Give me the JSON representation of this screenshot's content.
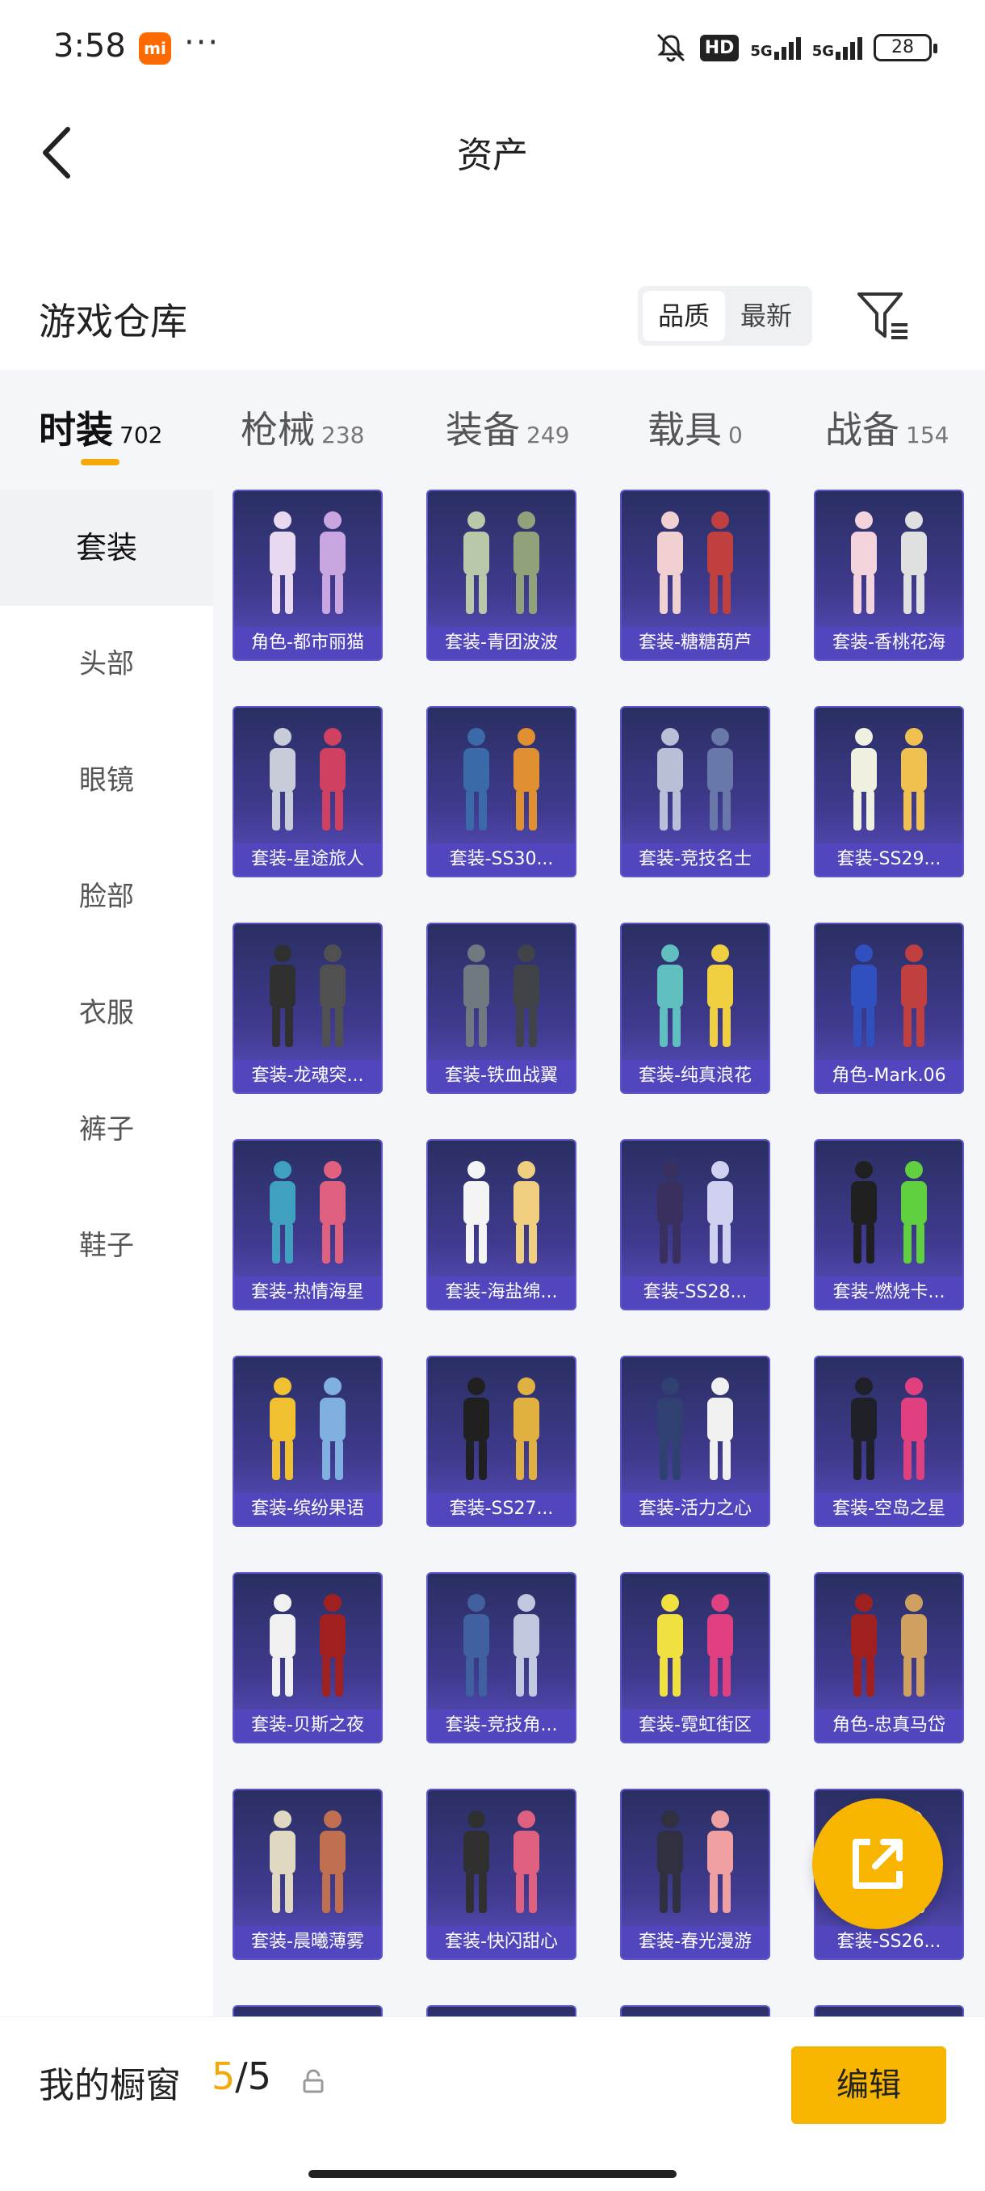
{
  "status_bar": {
    "time": "3:58",
    "app_icon": "mi-icon",
    "mi_text": "mi",
    "more": "···",
    "hd": "HD",
    "signal1": "5G",
    "signal2": "5G",
    "battery": "28"
  },
  "header": {
    "title": "资产"
  },
  "section": {
    "title": "游戏仓库",
    "sort_options": [
      "品质",
      "最新"
    ],
    "sort_active": "品质"
  },
  "tabs": [
    {
      "label": "时装",
      "count": "702",
      "active": true
    },
    {
      "label": "枪械",
      "count": "238",
      "active": false
    },
    {
      "label": "装备",
      "count": "249",
      "active": false
    },
    {
      "label": "载具",
      "count": "0",
      "active": false
    },
    {
      "label": "战备",
      "count": "154",
      "active": false
    }
  ],
  "sidebar": {
    "items": [
      {
        "label": "套装",
        "active": true
      },
      {
        "label": "头部",
        "active": false
      },
      {
        "label": "眼镜",
        "active": false
      },
      {
        "label": "脸部",
        "active": false
      },
      {
        "label": "衣服",
        "active": false
      },
      {
        "label": "裤子",
        "active": false
      },
      {
        "label": "鞋子",
        "active": false
      }
    ]
  },
  "items": [
    {
      "label": "角色-都市丽猫"
    },
    {
      "label": "套装-青团波波"
    },
    {
      "label": "套装-糖糖葫芦"
    },
    {
      "label": "套装-香桃花海"
    },
    {
      "label": "套装-星途旅人"
    },
    {
      "label": "套装-SS30..."
    },
    {
      "label": "套装-竞技名士"
    },
    {
      "label": "套装-SS29..."
    },
    {
      "label": "套装-龙魂突..."
    },
    {
      "label": "套装-铁血战翼"
    },
    {
      "label": "套装-纯真浪花"
    },
    {
      "label": "角色-Mark.06"
    },
    {
      "label": "套装-热情海星"
    },
    {
      "label": "套装-海盐绵..."
    },
    {
      "label": "套装-SS28..."
    },
    {
      "label": "套装-燃烧卡..."
    },
    {
      "label": "套装-缤纷果语"
    },
    {
      "label": "套装-SS27..."
    },
    {
      "label": "套装-活力之心"
    },
    {
      "label": "套装-空岛之星"
    },
    {
      "label": "套装-贝斯之夜"
    },
    {
      "label": "套装-竞技角..."
    },
    {
      "label": "套装-霓虹街区"
    },
    {
      "label": "角色-忠真马岱"
    },
    {
      "label": "套装-晨曦薄雾"
    },
    {
      "label": "套装-快闪甜心"
    },
    {
      "label": "套装-春光漫游"
    },
    {
      "label": "套装-SS26..."
    }
  ],
  "bottom": {
    "showcase_label": "我的橱窗",
    "showcase_current": "5",
    "showcase_total": "/5",
    "edit_label": "编辑"
  },
  "colors": {
    "accent": "#f7b500",
    "card_bg": "#3f3a8e",
    "card_label_bg": "#5246be"
  }
}
